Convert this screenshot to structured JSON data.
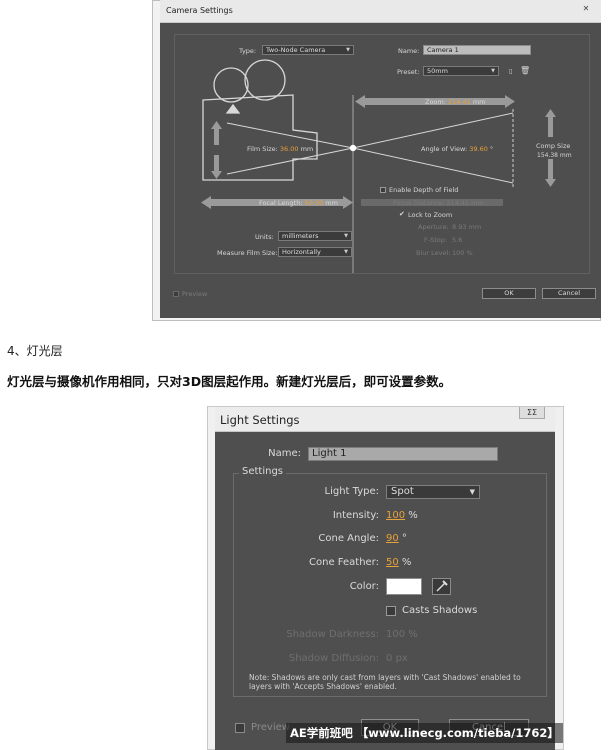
{
  "camera_dialog": {
    "title": "Camera Settings",
    "type_label": "Type:",
    "type_value": "Two-Node Camera",
    "name_label": "Name:",
    "name_value": "Camera 1",
    "preset_label": "Preset:",
    "preset_value": "50mm",
    "zoom_label": "Zoom:",
    "zoom_value": "214.41",
    "zoom_unit": "mm",
    "film_size_label": "Film Size:",
    "film_size_value": "36.00",
    "film_size_unit": "mm",
    "angle_label": "Angle of View:",
    "angle_value": "39.60",
    "angle_unit": "°",
    "comp_size_label": "Comp Size",
    "comp_size_value": "154.38 mm",
    "dof_label": "Enable Depth of Field",
    "focal_label": "Focal Length:",
    "focal_value": "50.00",
    "focal_unit": "mm",
    "focus_distance_label": "Focus Distance:",
    "focus_distance_value": "214.41",
    "focus_distance_unit": "mm",
    "lock_zoom_label": "Lock to Zoom",
    "aperture_label": "Aperture:",
    "aperture_value": "8.93 mm",
    "fstop_label": "F-Stop:",
    "fstop_value": "5.6",
    "blur_label": "Blur Level:",
    "blur_value": "100 %",
    "units_label": "Units:",
    "units_value": "millimeters",
    "measure_label": "Measure Film Size:",
    "measure_value": "Horizontally",
    "preview_label": "Preview",
    "ok_label": "OK",
    "cancel_label": "Cancel"
  },
  "article": {
    "heading": "4、灯光层",
    "body": "灯光层与摄像机作用相同，只对3D图层起作用。新建灯光层后，即可设置参数。"
  },
  "light_dialog": {
    "title": "Light Settings",
    "close_label": "ΣΣ",
    "name_label": "Name:",
    "name_value": "Light 1",
    "settings_title": "Settings",
    "light_type_label": "Light Type:",
    "light_type_value": "Spot",
    "intensity_label": "Intensity:",
    "intensity_value": "100",
    "intensity_unit": "%",
    "cone_angle_label": "Cone Angle:",
    "cone_angle_value": "90",
    "cone_angle_unit": "°",
    "cone_feather_label": "Cone Feather:",
    "cone_feather_value": "50",
    "cone_feather_unit": "%",
    "color_label": "Color:",
    "color_hex": "#ffffff",
    "casts_shadows_label": "Casts Shadows",
    "shadow_darkness_label": "Shadow Darkness:",
    "shadow_darkness_value": "100",
    "shadow_darkness_unit": "%",
    "shadow_diffusion_label": "Shadow Diffusion:",
    "shadow_diffusion_value": "0",
    "shadow_diffusion_unit": "px",
    "note": "Note: Shadows are only cast from layers with 'Cast Shadows' enabled to layers with 'Accepts Shadows' enabled.",
    "preview_label": "Preview",
    "ok_label": "OK",
    "cancel_label": "Cancel"
  },
  "watermark": "AE学前班吧 【www.linecg.com/tieba/1762】",
  "colors": {
    "dialog_bg": "#4f4f4f",
    "accent_value": "#e8a23a"
  }
}
